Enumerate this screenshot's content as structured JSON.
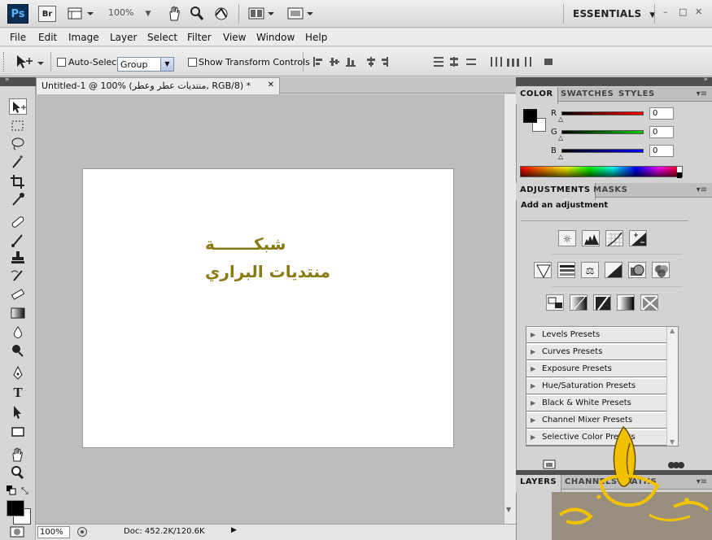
{
  "app": {
    "logo_text": "Ps",
    "bridge_text": "Br",
    "zoom_display": "100%",
    "workspace": "ESSENTIALS",
    "window_controls": [
      "–",
      "□",
      "✕"
    ]
  },
  "menu": [
    "File",
    "Edit",
    "Image",
    "Layer",
    "Select",
    "Filter",
    "View",
    "Window",
    "Help"
  ],
  "options": {
    "auto_select_label": "Auto-Select:",
    "auto_select_value": "Group",
    "show_transform_label": "Show Transform Controls"
  },
  "document": {
    "tab_title": "Untitled-1 @ 100% (منتديات عطر وعطر, RGB/8) *",
    "tab_close": "✕",
    "canvas_line1": "شبكـــــــة",
    "canvas_line2": "منتديات البراري",
    "text_color": "#8a7a14"
  },
  "status": {
    "zoom": "100%",
    "doc_info": "Doc: 452.2K/120.6K"
  },
  "color_panel": {
    "tabs": [
      "COLOR",
      "SWATCHES",
      "STYLES"
    ],
    "r_label": "R",
    "g_label": "G",
    "b_label": "B",
    "r_value": "0",
    "g_value": "0",
    "b_value": "0",
    "foreground": "#000000",
    "background": "#ffffff"
  },
  "adjustments_panel": {
    "tabs": [
      "ADJUSTMENTS",
      "MASKS"
    ],
    "heading": "Add an adjustment",
    "presets": [
      "Levels Presets",
      "Curves Presets",
      "Exposure Presets",
      "Hue/Saturation Presets",
      "Black & White Presets",
      "Channel Mixer Presets",
      "Selective Color Presets"
    ]
  },
  "layers_panel": {
    "tabs": [
      "LAYERS",
      "CHANNELS",
      "PATHS"
    ]
  },
  "watermark_text": "بسام"
}
